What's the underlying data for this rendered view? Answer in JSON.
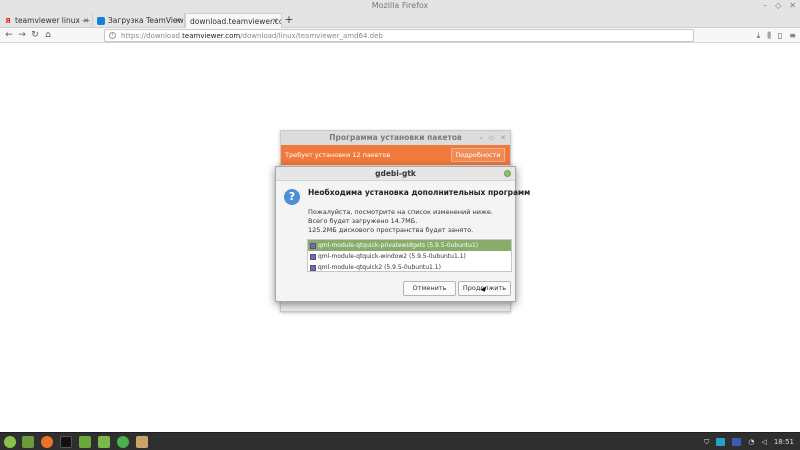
{
  "window": {
    "title": "Mozilla Firefox"
  },
  "tabs": [
    {
      "label": "teamviewer linux — Ян",
      "favicon": "Я"
    },
    {
      "label": "Загрузка TeamViewer",
      "favicon": ""
    },
    {
      "label": "download.teamviewer.com",
      "favicon": ""
    }
  ],
  "urlbar": {
    "prefix": "https://download.",
    "host": "teamviewer.com",
    "path": "/download/linux/teamviewer_amd64.deb"
  },
  "bg_installer": {
    "title": "Программа установки пакетов",
    "banner": "Требует установки 12 пакетов",
    "details_button": "Подробности"
  },
  "dialog": {
    "title": "gdebi-gtk",
    "heading": "Необходима установка дополнительных программ",
    "line1": "Пожалуйста, посмотрите на список изменений ниже.",
    "line2": "Всего будет загружено 14.7МБ.",
    "line3": "125.2МБ дискового пространства будет занято.",
    "packages": [
      "qml-module-qtquick-privatewidgets (5.9.5-0ubuntu1)",
      "qml-module-qtquick-window2 (5.9.5-0ubuntu1.1)",
      "qml-module-qtquick2 (5.9.5-0ubuntu1.1)"
    ],
    "cancel_label": "Отменить",
    "continue_label": "Продолжить"
  },
  "taskbar": {
    "time": "18:51"
  },
  "colors": {
    "banner": "#f07a3c",
    "selection": "#8aac6a",
    "accent": "#4c8fd6"
  }
}
